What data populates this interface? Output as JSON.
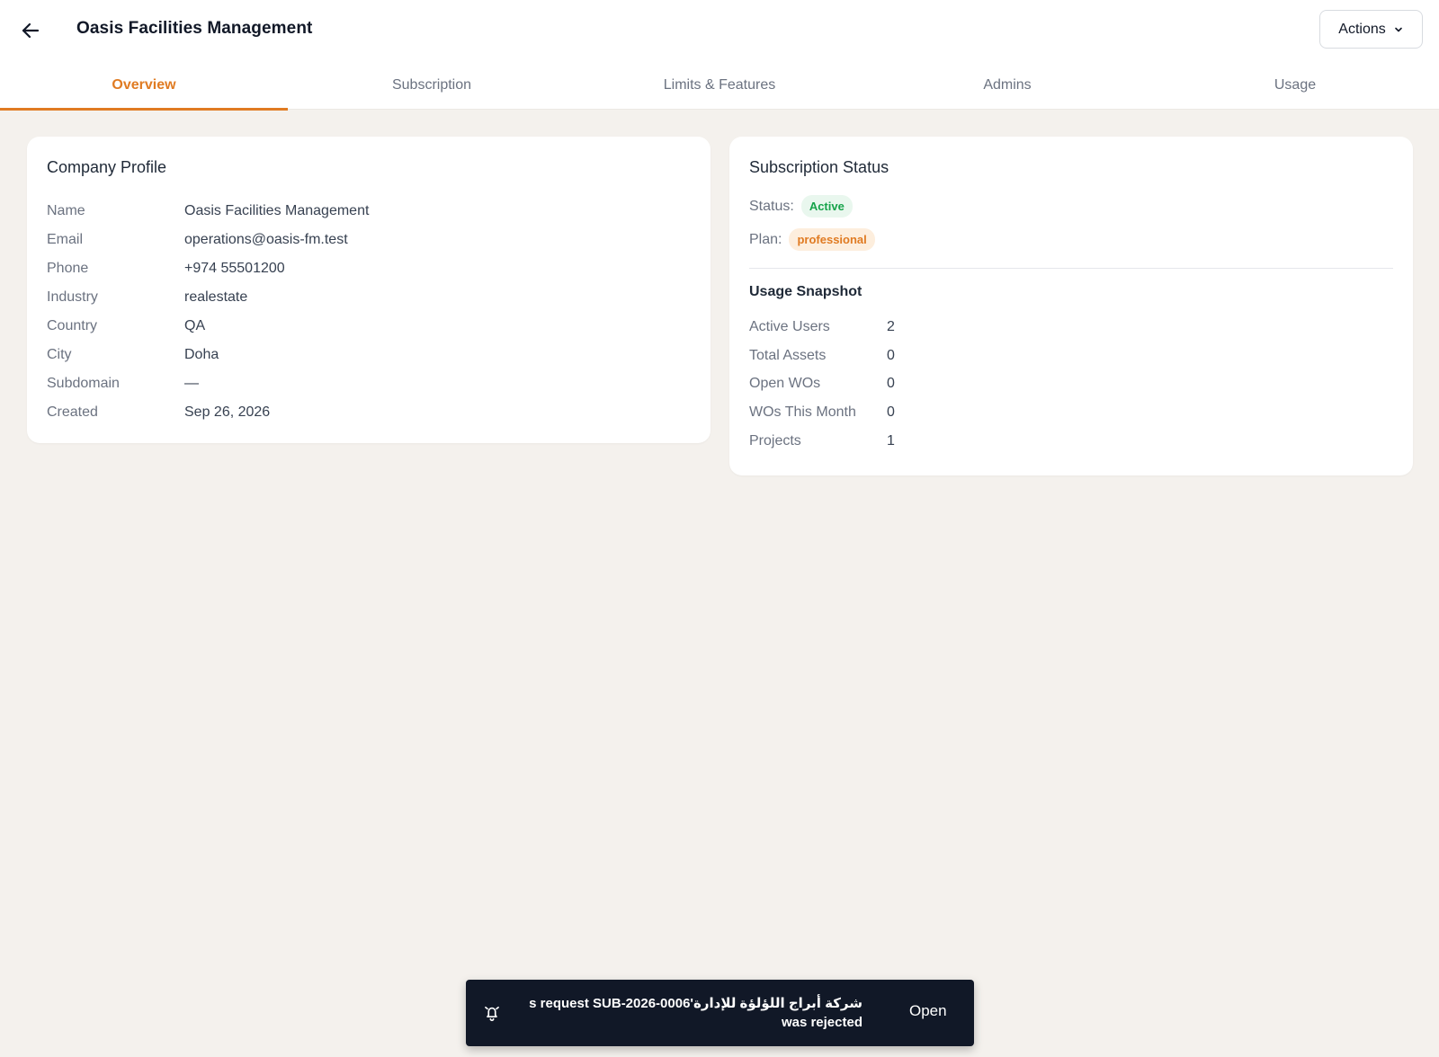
{
  "header": {
    "title": "Oasis Facilities Management",
    "actions_label": "Actions"
  },
  "tabs": [
    {
      "label": "Overview",
      "active": true
    },
    {
      "label": "Subscription",
      "active": false
    },
    {
      "label": "Limits & Features",
      "active": false
    },
    {
      "label": "Admins",
      "active": false
    },
    {
      "label": "Usage",
      "active": false
    }
  ],
  "company_profile": {
    "title": "Company Profile",
    "rows": [
      {
        "label": "Name",
        "value": "Oasis Facilities Management"
      },
      {
        "label": "Email",
        "value": "operations@oasis-fm.test"
      },
      {
        "label": "Phone",
        "value": "+974 55501200"
      },
      {
        "label": "Industry",
        "value": "realestate"
      },
      {
        "label": "Country",
        "value": "QA"
      },
      {
        "label": "City",
        "value": "Doha"
      },
      {
        "label": "Subdomain",
        "value": "—"
      },
      {
        "label": "Created",
        "value": "Sep 26, 2026"
      }
    ]
  },
  "subscription_status": {
    "title": "Subscription Status",
    "status_label": "Status:",
    "status_value": "Active",
    "plan_label": "Plan:",
    "plan_value": "professional",
    "snapshot_title": "Usage Snapshot",
    "snapshot": [
      {
        "label": "Active Users",
        "value": "2"
      },
      {
        "label": "Total Assets",
        "value": "0"
      },
      {
        "label": "Open WOs",
        "value": "0"
      },
      {
        "label": "WOs This Month",
        "value": "0"
      },
      {
        "label": "Projects",
        "value": "1"
      }
    ]
  },
  "toast": {
    "message": "شركة أبراج اللؤلؤة للإدارة's request SUB-2026-0006 was rejected",
    "action_label": "Open"
  },
  "colors": {
    "accent": "#e07b22",
    "background": "#f4f1ed",
    "active_badge_text": "#16a34a",
    "toast_bg": "#111827"
  }
}
